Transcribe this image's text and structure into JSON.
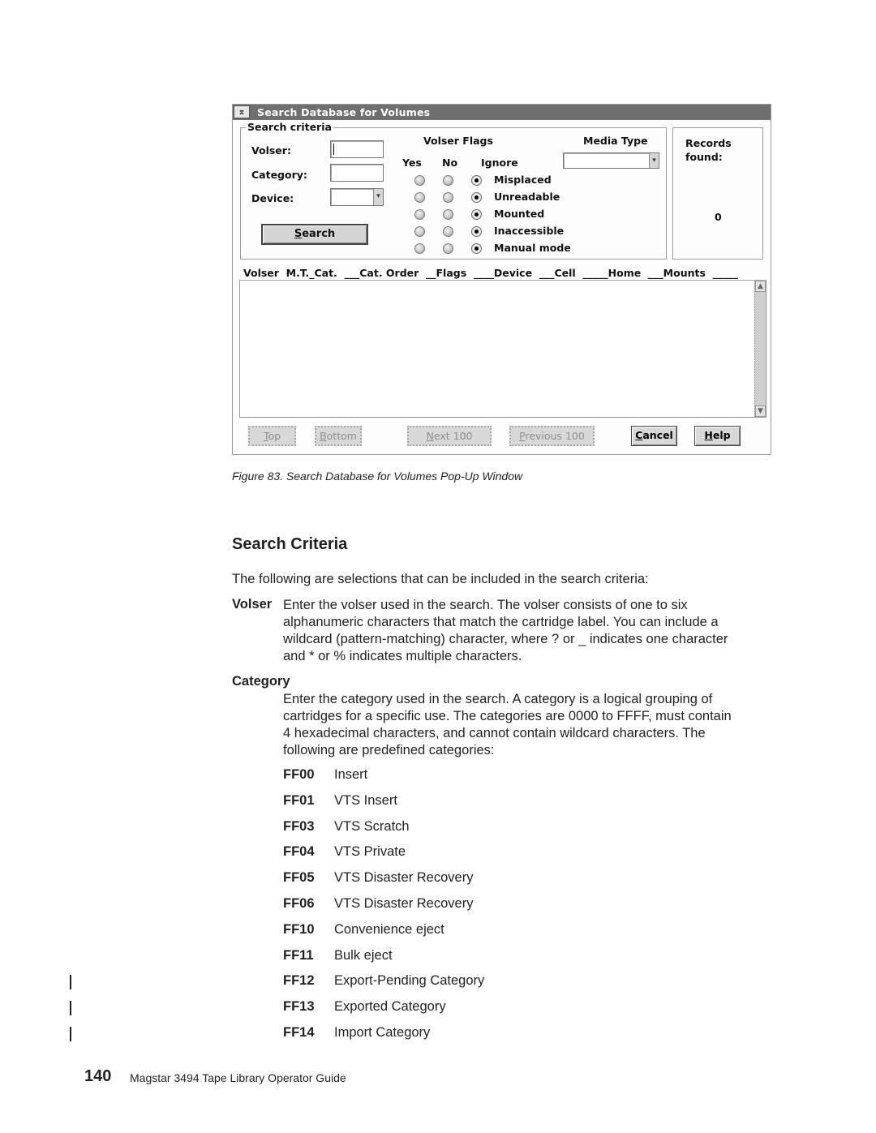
{
  "dialog": {
    "title": "Search Database for Volumes",
    "system_menu_glyph": "⌅",
    "group_label": "Search criteria",
    "volser_label": "Volser:",
    "volser_value": "",
    "category_label": "Category:",
    "category_value": "",
    "device_label": "Device:",
    "device_value": "",
    "search_button": {
      "prefix": "",
      "mnemonic": "S",
      "rest": "earch"
    },
    "volser_flags_title": "Volser Flags",
    "flag_cols": [
      "Yes",
      "No",
      "Ignore"
    ],
    "flags": [
      {
        "label": "Misplaced",
        "selected": "Ignore"
      },
      {
        "label": "Unreadable",
        "selected": "Ignore"
      },
      {
        "label": "Mounted",
        "selected": "Ignore"
      },
      {
        "label": "Inaccessible",
        "selected": "Ignore"
      },
      {
        "label": "Manual mode",
        "selected": "Ignore"
      }
    ],
    "media_type_label": "Media Type",
    "media_type_value": "",
    "records_found_label_1": "Records",
    "records_found_label_2": "found:",
    "records_found_value": "0",
    "column_headers": "Volser  M.T._Cat.  ___Cat. Order  __Flags  ____Device  ___Cell  _____Home  ___Mounts  _____",
    "buttons": {
      "top": {
        "mnemonic": "T",
        "rest": "op"
      },
      "bottom": {
        "mnemonic": "B",
        "rest": "ottom"
      },
      "next": {
        "mnemonic": "N",
        "rest": "ext 100"
      },
      "previous": {
        "mnemonic": "P",
        "rest": "revious 100"
      },
      "cancel": {
        "mnemonic": "C",
        "rest": "ancel"
      },
      "help": {
        "mnemonic": "H",
        "rest": "elp"
      }
    }
  },
  "caption": "Figure 83. Search Database for Volumes Pop-Up Window",
  "section_title": "Search Criteria",
  "intro": "The following are selections that can be included in the search criteria:",
  "volser_term": "Volser",
  "volser_lines": [
    "Enter the volser used in the search. The volser consists of one to six",
    "alphanumeric characters that match the cartridge label. You can include a",
    "wildcard (pattern-matching) character, where ? or _ indicates one character",
    "and * or % indicates multiple characters."
  ],
  "category_term": "Category",
  "category_lines": [
    "Enter the category used in the search. A category is a logical grouping of",
    "cartridges for a specific use. The categories are 0000 to FFFF, must contain",
    "4 hexadecimal characters, and cannot contain wildcard characters. The",
    "following are predefined categories:"
  ],
  "categories": [
    {
      "code": "FF00",
      "desc": "Insert",
      "revised": false
    },
    {
      "code": "FF01",
      "desc": "VTS Insert",
      "revised": false
    },
    {
      "code": "FF03",
      "desc": "VTS Scratch",
      "revised": false
    },
    {
      "code": "FF04",
      "desc": "VTS Private",
      "revised": false
    },
    {
      "code": "FF05",
      "desc": "VTS Disaster Recovery",
      "revised": false
    },
    {
      "code": "FF06",
      "desc": "VTS Disaster Recovery",
      "revised": false
    },
    {
      "code": "FF10",
      "desc": "Convenience eject",
      "revised": false
    },
    {
      "code": "FF11",
      "desc": "Bulk eject",
      "revised": false
    },
    {
      "code": "FF12",
      "desc": "Export-Pending Category",
      "revised": true
    },
    {
      "code": "FF13",
      "desc": "Exported Category",
      "revised": true
    },
    {
      "code": "FF14",
      "desc": "Import Category",
      "revised": true
    }
  ],
  "footer": {
    "page_number": "140",
    "title": "Magstar 3494 Tape Library Operator Guide"
  }
}
